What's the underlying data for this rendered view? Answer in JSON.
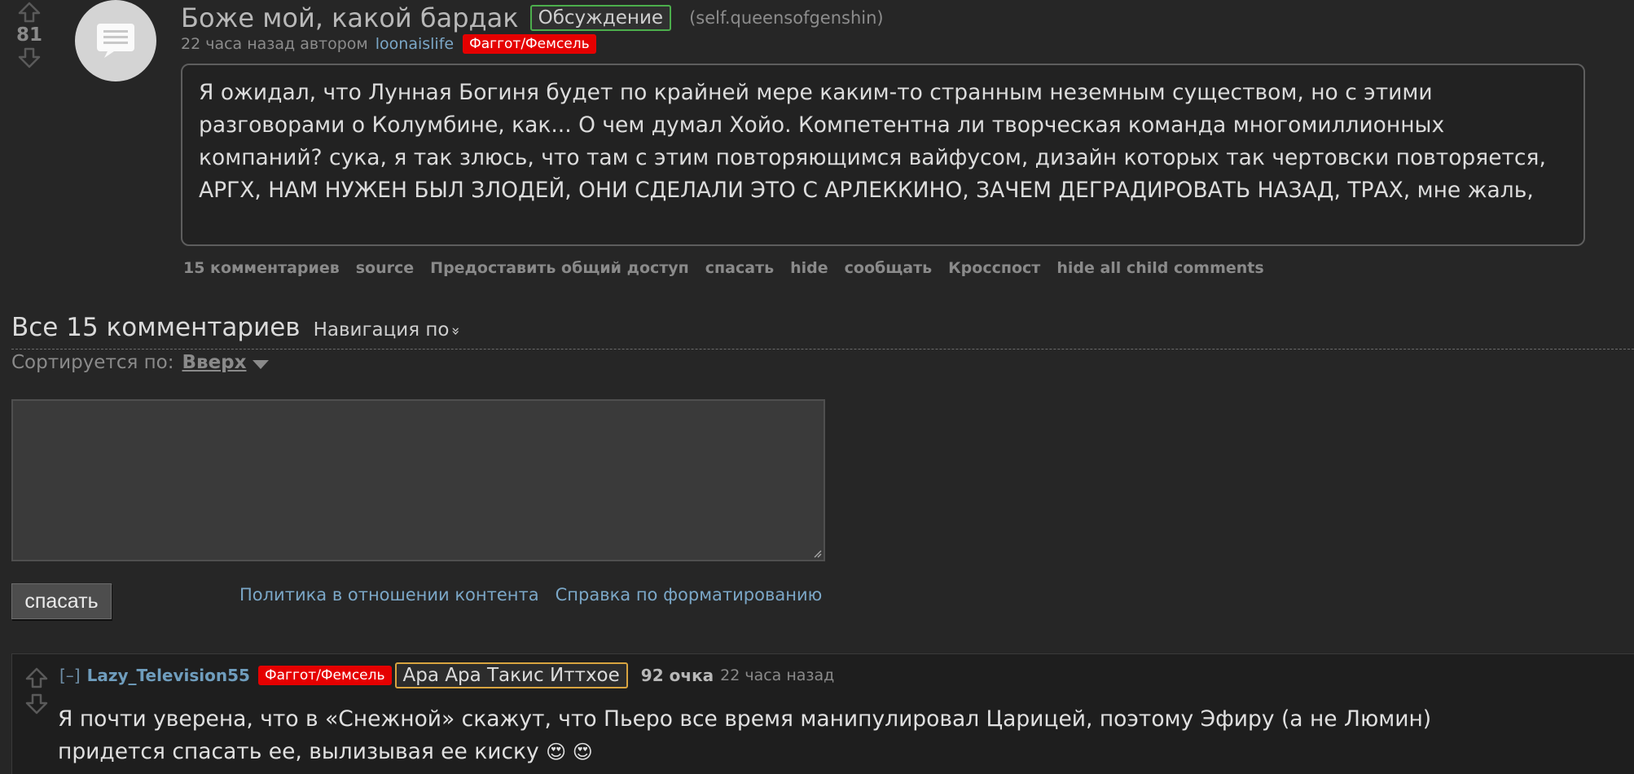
{
  "post": {
    "score": "81",
    "title": "Боже мой, какой бардак",
    "link_flair": "Обсуждение",
    "domain": "(self.queensofgenshin)",
    "submitted": "22 часа назад автором",
    "author": "loonaislife",
    "author_flair": "Фаггот/Фемсель",
    "selftext": "Я ожидал, что Лунная Богиня будет по крайней мере каким-то странным неземным существом, но с этими разговорами о Колумбине, как... О чем думал Хойо. Компетентна ли творческая команда многомиллионных компаний? сука, я так злюсь, что там с этим повторяющимся вайфусом, дизайн которых так чертовски повторяется, АРГХ, НАМ НУЖЕН БЫЛ ЗЛОДЕЙ, ОНИ СДЕЛАЛИ ЭТО С АРЛЕККИНО, ЗАЧЕМ ДЕГРАДИРОВАТЬ НАЗАД, ТРАХ, мне жаль,",
    "buttons": {
      "comments": "15 комментариев",
      "source": "source",
      "share": "Предоставить общий доступ",
      "save": "спасать",
      "hide": "hide",
      "report": "сообщать",
      "crosspost": "Кросспост",
      "hide_children": "hide all child comments"
    }
  },
  "comments_area": {
    "title": "Все 15 комментариев",
    "nav_by": "Навигация по",
    "nav_chevron": "»",
    "sorted_by_label": "Сортируется по:",
    "sort_value": "Вверх",
    "reply_placeholder": "",
    "save_button": "спасать",
    "content_policy": "Политика в отношении контента",
    "formatting_help": "Справка по форматированию"
  },
  "comment": {
    "collapse": "[–]",
    "author": "Lazy_Television55",
    "author_flair": "Фаггот/Фемсель",
    "user_flair": "Ара Ара Такис Иттхое",
    "points": "92 очка",
    "time": "22 часа назад",
    "body": "Я почти уверена, что в «Снежной» скажут, что Пьеро все время манипулировал Царицей, поэтому Эфиру (а не Люмин) придется спасать ее, вылизывая ее киску",
    "emoji": "😍 😍"
  },
  "icons": {
    "upvote": "arrow-up-outline-icon",
    "downvote": "arrow-down-outline-icon",
    "self_thumbnail": "text-document-icon",
    "sort_caret": "triangle-down-icon",
    "resize_grip": "resize-grip-icon"
  },
  "colors": {
    "background": "#262626",
    "link_blue": "#7ba7c7",
    "flair_red": "#e50000",
    "flair_green_border": "#4cae4c",
    "flair_orange_border": "#d8a440"
  }
}
